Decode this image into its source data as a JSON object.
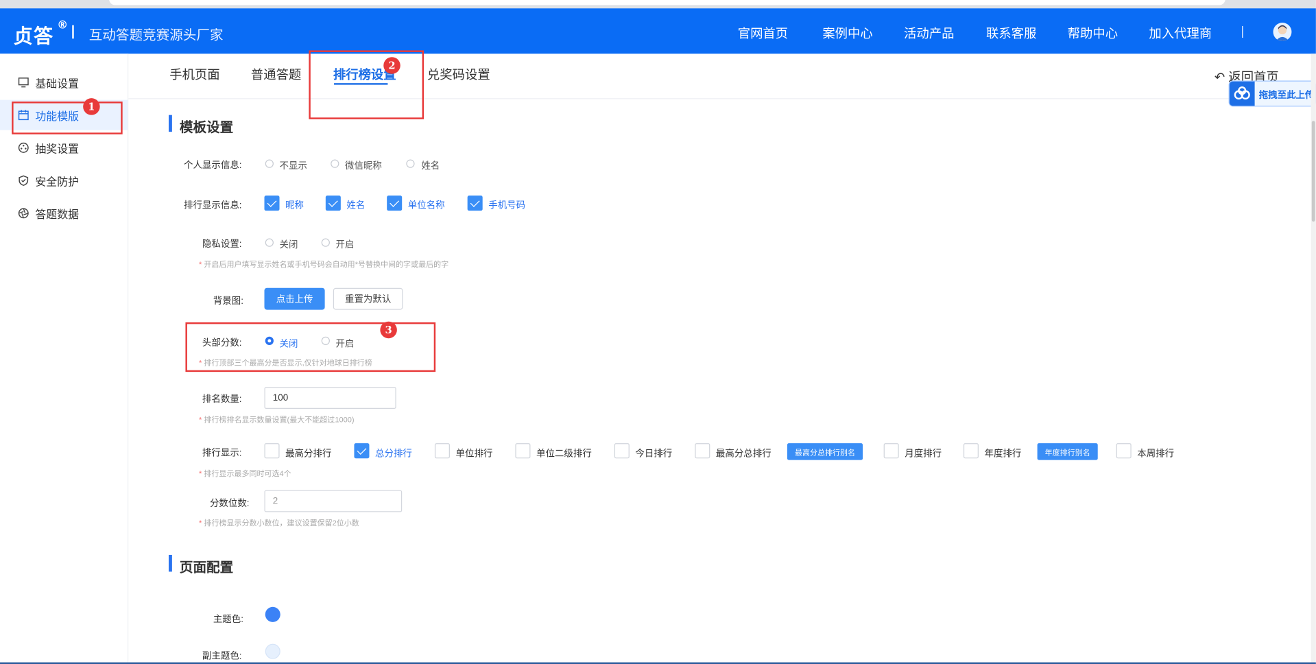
{
  "header": {
    "logo": "贞答",
    "logo_mark": "®",
    "slogan": "互动答题竞赛源头厂家",
    "nav": [
      "官网首页",
      "案例中心",
      "活动产品",
      "联系客服",
      "帮助中心",
      "加入代理商"
    ],
    "colors": {
      "bar": "#0a6cf5",
      "accent": "#2a73f0",
      "annotation": "#e83a3a"
    }
  },
  "sidebar": {
    "items": [
      {
        "label": "基础设置",
        "icon": "monitor-icon"
      },
      {
        "label": "功能模版",
        "icon": "calendar-icon"
      },
      {
        "label": "抽奖设置",
        "icon": "lottery-wheel-icon"
      },
      {
        "label": "安全防护",
        "icon": "shield-icon"
      },
      {
        "label": "答题数据",
        "icon": "aperture-icon"
      }
    ],
    "active_index": 1
  },
  "tabs": {
    "items": [
      "手机页面",
      "普通答题",
      "排行榜设置",
      "兑奖码设置"
    ],
    "active_index": 2
  },
  "back_link": "返回首页",
  "upload_float": "拖拽至此上传",
  "annotations": [
    "1",
    "2",
    "3"
  ],
  "template_section": {
    "title": "模板设置",
    "personal_info": {
      "label": "个人显示信息:",
      "options": [
        "不显示",
        "微信昵称",
        "姓名"
      ],
      "selected": null
    },
    "rank_info": {
      "label": "排行显示信息:",
      "options": [
        {
          "label": "昵称",
          "checked": true
        },
        {
          "label": "姓名",
          "checked": true
        },
        {
          "label": "单位名称",
          "checked": true
        },
        {
          "label": "手机号码",
          "checked": true
        }
      ]
    },
    "privacy": {
      "label": "隐私设置:",
      "options": [
        "关闭",
        "开启"
      ],
      "selected": null,
      "hint": "开启后用户填写显示姓名或手机号码会自动用*号替换中间的字或最后的字"
    },
    "background": {
      "label": "背景图:",
      "upload_button": "点击上传",
      "reset_button": "重置为默认"
    },
    "head_score": {
      "label": "头部分数:",
      "options": [
        "关闭",
        "开启"
      ],
      "selected": 0,
      "hint": "排行顶部三个最高分是否显示,仅针对地球日排行榜"
    },
    "rank_count": {
      "label": "排名数量:",
      "value": "100",
      "hint": "排行榜排名显示数量设置(最大不能超过1000)"
    },
    "rank_display": {
      "label": "排行显示:",
      "options": [
        {
          "label": "最高分排行",
          "checked": false
        },
        {
          "label": "总分排行",
          "checked": true
        },
        {
          "label": "单位排行",
          "checked": false
        },
        {
          "label": "单位二级排行",
          "checked": false
        },
        {
          "label": "今日排行",
          "checked": false
        },
        {
          "label": "最高分总排行",
          "checked": false
        },
        {
          "label": "月度排行",
          "checked": false
        },
        {
          "label": "年度排行",
          "checked": false
        },
        {
          "label": "本周排行",
          "checked": false
        }
      ],
      "alias_tags": [
        "最高分总排行别名",
        "年度排行别名"
      ],
      "hint": "排行显示最多同时可选4个"
    },
    "decimals": {
      "label": "分数位数:",
      "placeholder": "2",
      "hint": "排行榜显示分数小数位，建议设置保留2位小数"
    }
  },
  "page_section": {
    "title": "页面配置",
    "theme_color": {
      "label": "主题色:",
      "color": "#3b82f6"
    },
    "sub_theme_color": {
      "label": "副主题色:",
      "color": "#e6f0fd"
    }
  }
}
